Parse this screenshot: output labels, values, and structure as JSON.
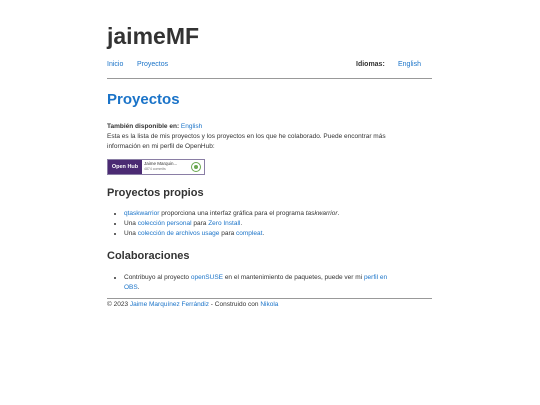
{
  "site_title": "jaimeMF",
  "nav": {
    "inicio": "Inicio",
    "proyectos": "Proyectos",
    "idiomas_label": "Idiomas:",
    "english": "English"
  },
  "main": {
    "heading": "Proyectos",
    "available_label": "También disponible en:",
    "available_lang": "English",
    "intro_line1": "Esta es la lista de mis proyectos y los proyectos en los que he colaborado. Puede encontrar más",
    "intro_line2": "información en mi perfil de OpenHub:",
    "badge": {
      "brand": "Open Hub",
      "name": "Jaime Marquin...",
      "commits": "4874 commits"
    },
    "own_projects": {
      "heading": "Proyectos propios",
      "item1": {
        "link": "qtaskwarrior",
        "text": " proporciona una interfaz gráfica para el programa ",
        "em": "taskwarrior",
        "end": "."
      },
      "item2": {
        "pre": "Una ",
        "link1": "colección personal",
        "mid": " para ",
        "link2": "Zero Install",
        "end": "."
      },
      "item3": {
        "pre": "Una ",
        "link1": "colección de archivos usage",
        "mid": " para ",
        "link2": "compleat",
        "end": "."
      }
    },
    "collaborations": {
      "heading": "Colaboraciones",
      "item1": {
        "pre": "Contribuyo al proyecto ",
        "link1": "openSUSE",
        "mid": " en el mantenimiento de paquetes, puede ver mi ",
        "link2a": "perfil en",
        "link2b": "OBS",
        "end": "."
      }
    }
  },
  "footer": {
    "copyright": "© 2023 ",
    "author": "Jaime Marquínez Ferrándiz",
    "built": " - Construido con ",
    "engine": "Nikola"
  },
  "colors": {
    "link": "#1a73c8",
    "text": "#333333",
    "rule": "#999999",
    "openhub_purple": "#4b2a73"
  }
}
